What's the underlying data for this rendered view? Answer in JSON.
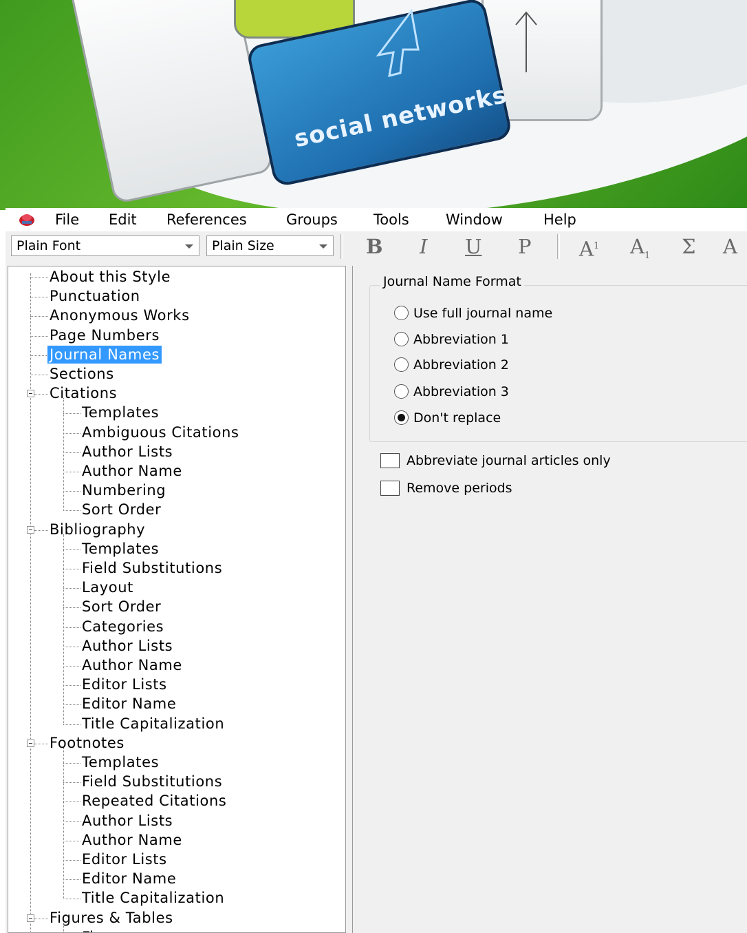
{
  "banner": {
    "key_text": "social networks"
  },
  "menu": [
    "File",
    "Edit",
    "References",
    "Groups",
    "Tools",
    "Window",
    "Help"
  ],
  "toolbar": {
    "font_value": "Plain Font",
    "size_value": "Plain Size",
    "bold": "B",
    "italic": "I",
    "underline": "U",
    "plain": "P",
    "superscript_base": "A",
    "superscript_mark": "1",
    "subscript_base": "A",
    "subscript_mark": "1",
    "symbol": "Σ",
    "last_partial": "A"
  },
  "tree": {
    "top_items": [
      "About this Style",
      "Punctuation",
      "Anonymous Works",
      "Page Numbers",
      "Journal Names",
      "Sections"
    ],
    "selected": "Journal Names",
    "groups": [
      {
        "label": "Citations",
        "children": [
          "Templates",
          "Ambiguous Citations",
          "Author Lists",
          "Author Name",
          "Numbering",
          "Sort Order"
        ]
      },
      {
        "label": "Bibliography",
        "children": [
          "Templates",
          "Field Substitutions",
          "Layout",
          "Sort Order",
          "Categories",
          "Author Lists",
          "Author Name",
          "Editor Lists",
          "Editor Name",
          "Title Capitalization"
        ]
      },
      {
        "label": "Footnotes",
        "children": [
          "Templates",
          "Field Substitutions",
          "Repeated Citations",
          "Author Lists",
          "Author Name",
          "Editor Lists",
          "Editor Name",
          "Title Capitalization"
        ]
      },
      {
        "label": "Figures & Tables",
        "children": [
          "Figures"
        ]
      }
    ]
  },
  "panel": {
    "group_title": "Journal Name Format",
    "options": [
      {
        "label": "Use full journal name",
        "checked": false
      },
      {
        "label": "Abbreviation 1",
        "checked": false
      },
      {
        "label": "Abbreviation 2",
        "checked": false
      },
      {
        "label": "Abbreviation 3",
        "checked": false
      },
      {
        "label": "Don't replace",
        "checked": true
      }
    ],
    "checkboxes": [
      {
        "label": "Abbreviate journal articles only",
        "checked": false
      },
      {
        "label": "Remove periods",
        "checked": false
      }
    ]
  }
}
